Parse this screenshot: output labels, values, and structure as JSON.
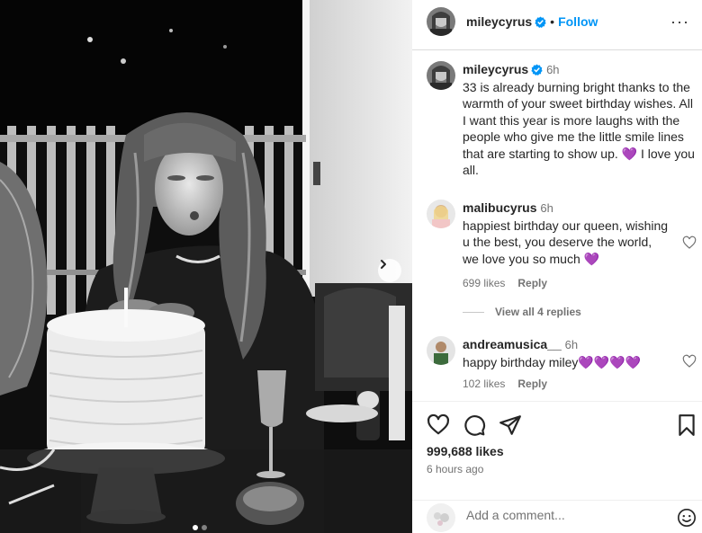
{
  "post": {
    "photo_alt": "Woman blowing out a candle on a birthday cake",
    "carousel": {
      "count": 2,
      "active_index": 0
    }
  },
  "header": {
    "username": "mileycyrus",
    "separator": "•",
    "follow_label": "Follow",
    "more_label": "···"
  },
  "caption": {
    "username": "mileycyrus",
    "time": "6h",
    "text": "33 is already burning bright thanks to the warmth of your sweet birthday wishes. All I want this year is more laughs with the people who give me the little smile lines that are starting to show up. 💜 I love you all."
  },
  "comments": [
    {
      "username": "malibucyrus",
      "time": "6h",
      "text": "happiest birthday our queen, wishing u the best, you deserve the world, we love you so much 💜",
      "likes": "699 likes",
      "reply_label": "Reply"
    },
    {
      "username": "andreamusica__",
      "time": "6h",
      "text": "happy birthday miley💜💜💜💜",
      "likes": "102 likes",
      "reply_label": "Reply"
    }
  ],
  "view_replies_label": "View all 4 replies",
  "stats": {
    "likes": "999,688 likes",
    "posted": "6 hours ago"
  },
  "composer": {
    "placeholder": "Add a comment..."
  },
  "colors": {
    "accent": "#0095f6",
    "verified": "#0095f6",
    "text": "#262626",
    "muted": "#737373",
    "heart_emoji": "#7b3b62"
  },
  "icons": {
    "like": "heart-icon",
    "comment": "comment-icon",
    "share": "send-icon",
    "save": "bookmark-icon",
    "emoji": "smiley-icon",
    "next": "chevron-right-icon",
    "more": "more-icon",
    "verified": "verified-badge-icon"
  }
}
